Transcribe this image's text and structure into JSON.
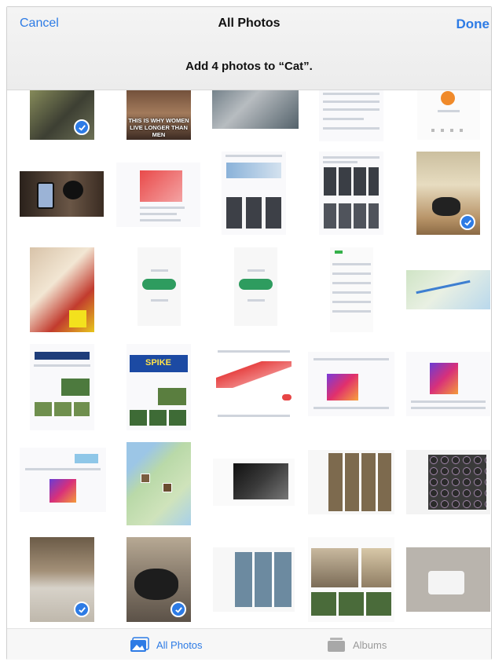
{
  "nav": {
    "cancel_label": "Cancel",
    "title": "All Photos",
    "done_label": "Done",
    "prompt": "Add 4 photos to “Cat”."
  },
  "overlays": {
    "meme_text": "THIS IS WHY WOMEN LIVE LONGER THAN MEN",
    "spike": "SPIKE"
  },
  "tabs": {
    "all_photos": "All Photos",
    "albums": "Albums"
  },
  "colors": {
    "accent": "#2d7be5"
  },
  "selected_count": 4
}
